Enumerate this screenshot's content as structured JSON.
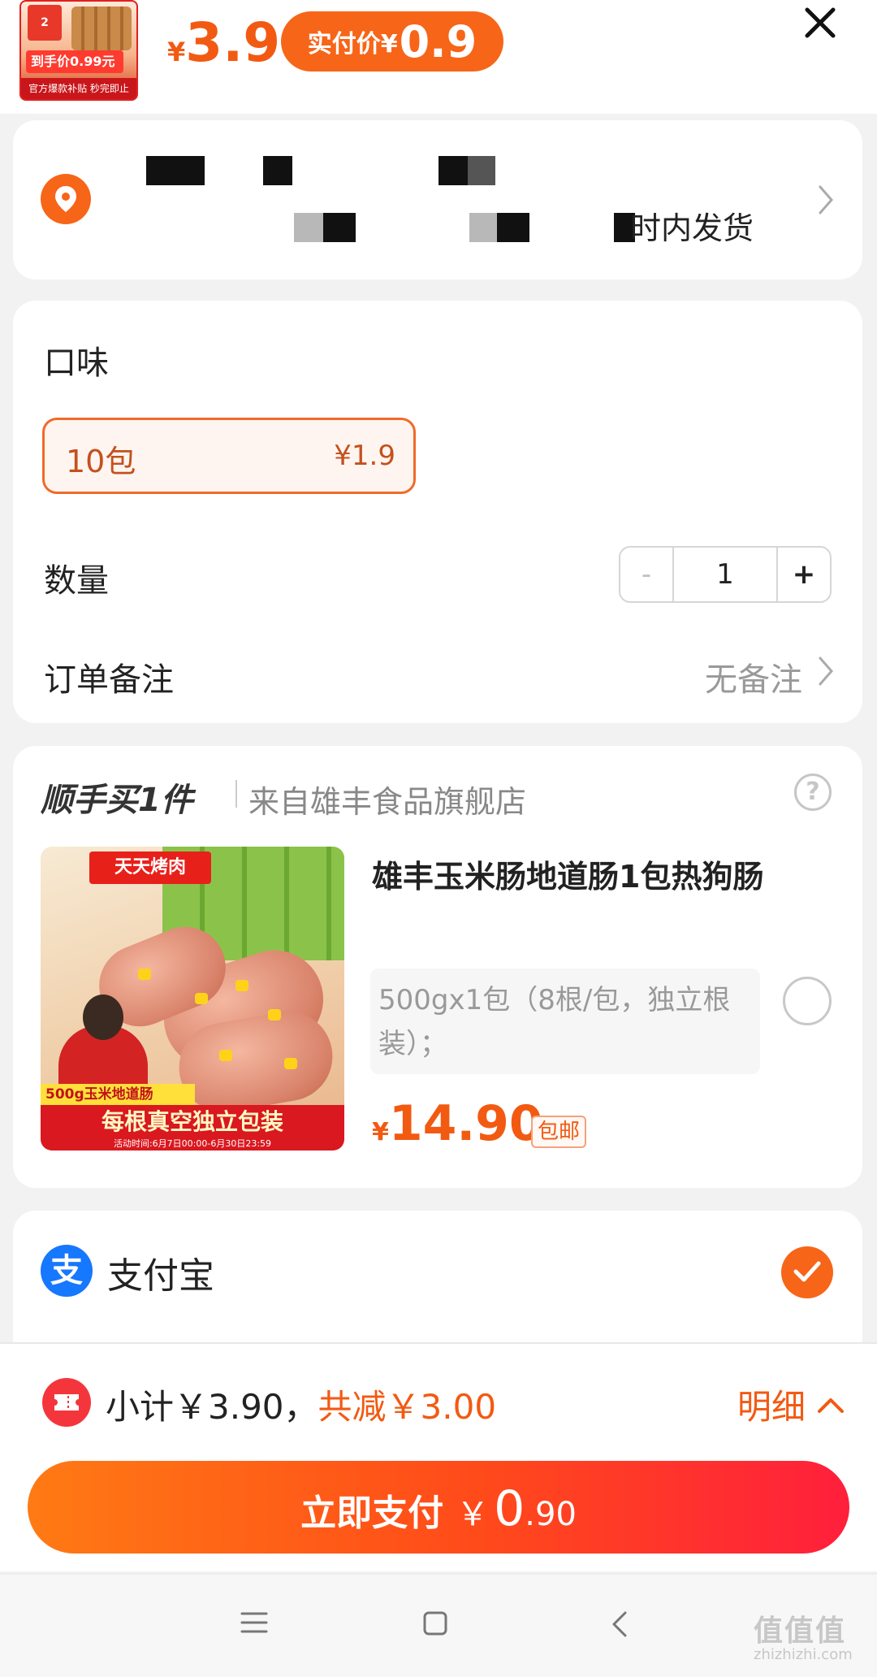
{
  "header": {
    "thumb": {
      "badge": "2",
      "price_tag": "到手价0.99元",
      "footer": "官方爆款补贴 秒完即止"
    },
    "price_currency": "¥",
    "price": "3.9",
    "actual_label": "实付价¥",
    "actual_price": "0.9"
  },
  "address": {
    "ship_time_text": "时内发货"
  },
  "options": {
    "flavor_label": "口味",
    "variant": {
      "name": "10包",
      "price": "¥1.9"
    },
    "quantity_label": "数量",
    "quantity": {
      "minus": "-",
      "value": "1",
      "plus": "+"
    },
    "remark_label": "订单备注",
    "remark_value": "无备注"
  },
  "upsell": {
    "title": "顺手买1件",
    "store": "来自雄丰食品旗舰店",
    "help": "?",
    "product": {
      "image_banner": "天天烤肉",
      "image_weight_label": "500g玉米地道肠",
      "image_band": "每根真空独立包装",
      "image_promo_time": "活动时间:6月7日00:00-6月30日23:59",
      "name": "雄丰玉米肠地道肠1包热狗肠",
      "spec": "500gx1包（8根/包，独立根装）；",
      "price_currency": "¥",
      "price": "14.90",
      "shipping_tag": "包邮"
    }
  },
  "payment": {
    "method": "支付宝",
    "icon_glyph": "支"
  },
  "summary": {
    "subtotal": "小计￥3.90，",
    "discount": "共减￥3.00",
    "detail_label": "明细"
  },
  "pay_button": {
    "label": "立即支付",
    "currency": "￥",
    "integer": "0",
    "decimal": ".90"
  },
  "watermark": {
    "main": "值值值",
    "sub": "zhizhizhi.com"
  },
  "icons": [
    "close-icon",
    "location-icon",
    "chevron-right-icon",
    "help-icon",
    "alipay-icon",
    "checkmark-icon",
    "coupon-icon",
    "chevron-up-icon",
    "menu-icon",
    "home-square-icon",
    "back-icon"
  ],
  "colors": {
    "accent": "#f76518",
    "price": "#f25a12",
    "alipay": "#1677ff",
    "coupon": "#f4363c"
  }
}
